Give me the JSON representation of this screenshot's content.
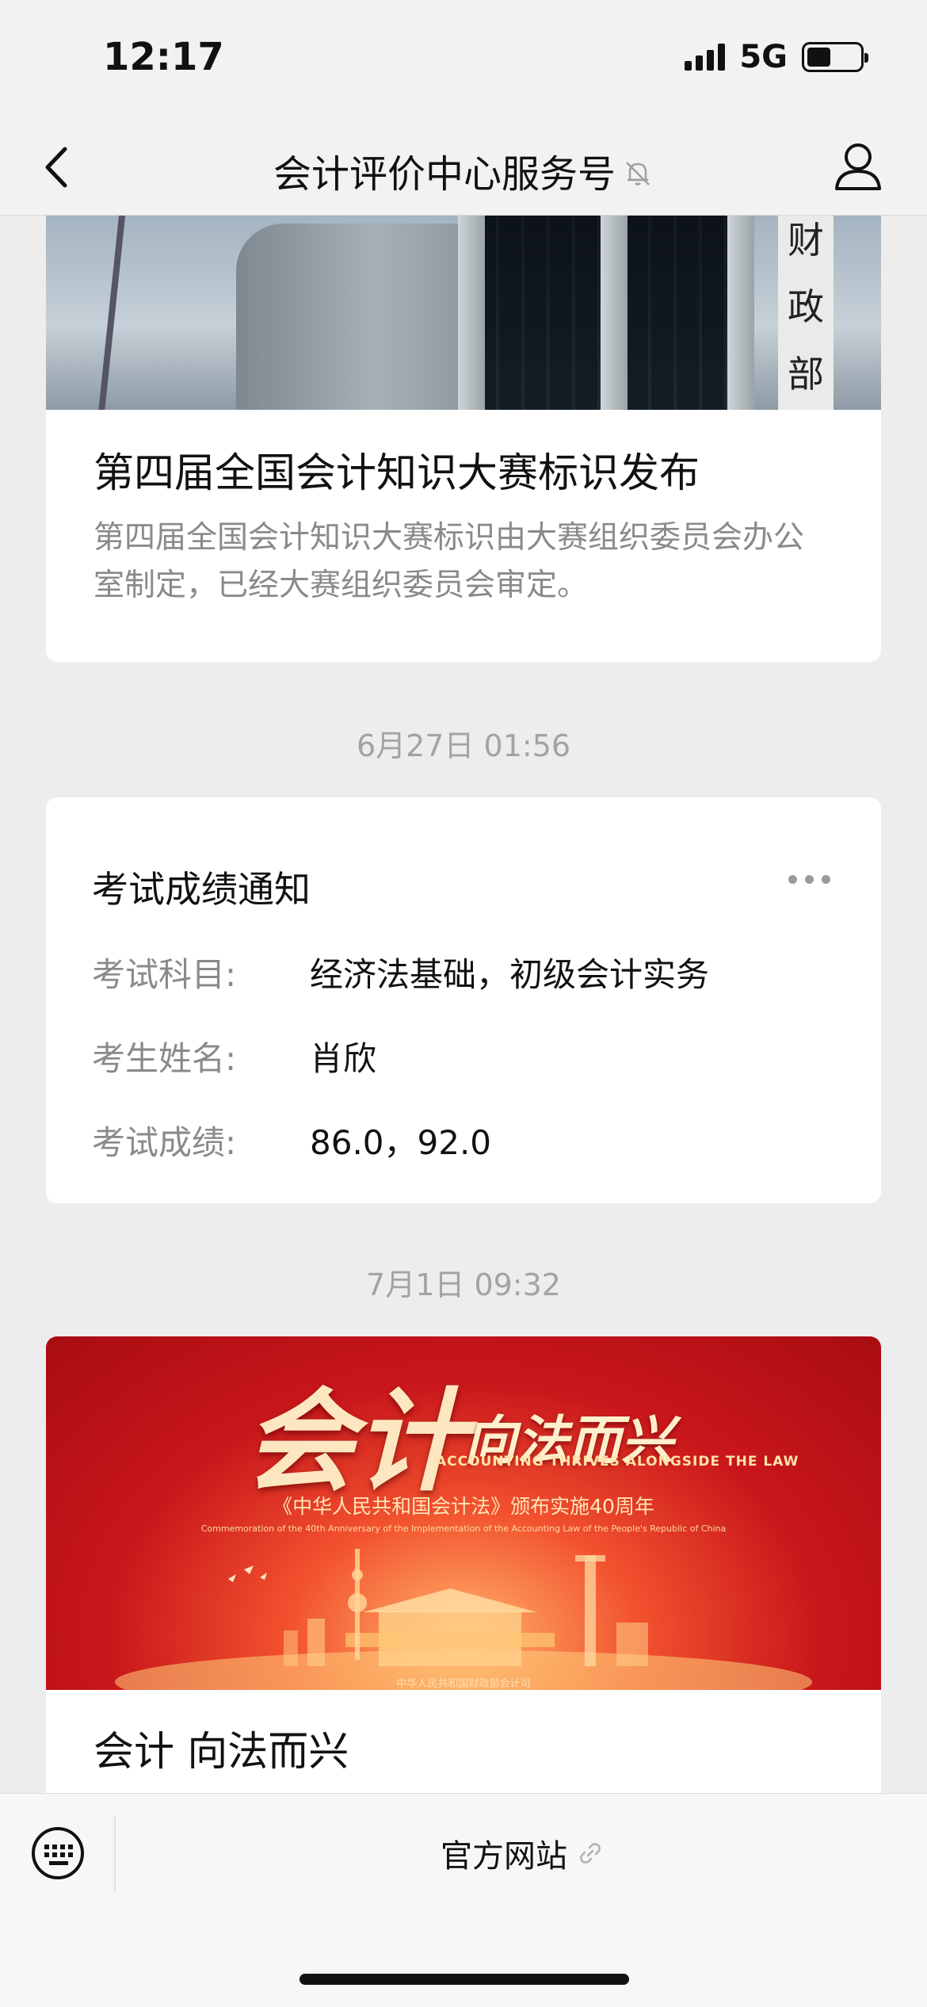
{
  "status_bar": {
    "time": "12:17",
    "network": "5G",
    "battery_level": 0.45
  },
  "nav": {
    "title": "会计评价中心服务号",
    "back_icon": "chevron-left-icon",
    "mute_icon": "bell-off-icon",
    "profile_icon": "user-icon"
  },
  "messages": [
    {
      "type": "article",
      "image_sign": [
        "财",
        "政",
        "部"
      ],
      "title": "第四届全国会计知识大赛标识发布",
      "description": "第四届全国会计知识大赛标识由大赛组织委员会办公室制定，已经大赛组织委员会审定。"
    },
    {
      "type": "timestamp",
      "text": "6月27日 01:56"
    },
    {
      "type": "notice",
      "title": "考试成绩通知",
      "more_icon": "more-dots-icon",
      "rows": [
        {
          "label": "考试科目:",
          "value": "经济法基础，初级会计实务"
        },
        {
          "label": "考生姓名:",
          "value": "肖欣"
        },
        {
          "label": "考试成绩:",
          "value": "86.0，92.0"
        }
      ]
    },
    {
      "type": "timestamp",
      "text": "7月1日 09:32"
    },
    {
      "type": "article",
      "banner": {
        "big": "会计",
        "slogan": "向法而兴",
        "english": "ACCOUNTING THRIVES ALONGSIDE THE LAW",
        "subtitle": "《中华人民共和国会计法》颁布实施40周年",
        "subtitle_en": "Commemoration of the 40th Anniversary of the Implementation of the Accounting Law of the People's Republic of China",
        "credit": "中华人民共和国财政部会计司"
      },
      "title": "会计 向法而兴"
    }
  ],
  "bottom_bar": {
    "keyboard_icon": "keyboard-icon",
    "menu_label": "官方网站",
    "link_icon": "link-icon"
  }
}
